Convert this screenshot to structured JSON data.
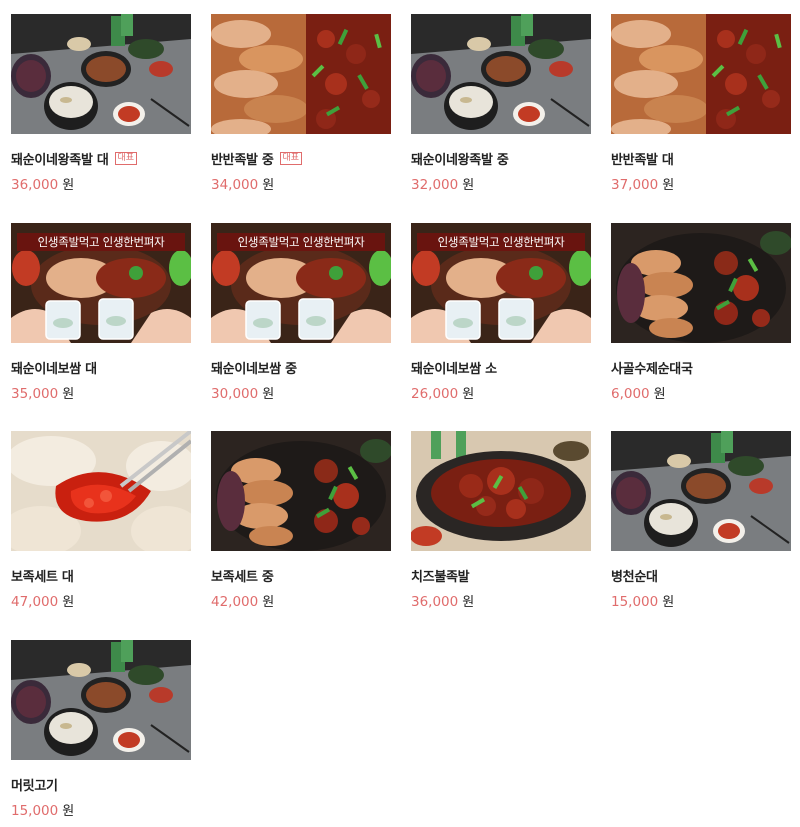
{
  "products": [
    {
      "name": "돼순이네왕족발 대",
      "price": "36,000",
      "unit": "원",
      "badge": "대표",
      "banner": "",
      "photo": "table-spread"
    },
    {
      "name": "반반족발 중",
      "price": "34,000",
      "unit": "원",
      "badge": "대표",
      "banner": "",
      "photo": "half-half-jokbal"
    },
    {
      "name": "돼순이네왕족발 중",
      "price": "32,000",
      "unit": "원",
      "badge": "",
      "banner": "",
      "photo": "table-spread"
    },
    {
      "name": "반반족발 대",
      "price": "37,000",
      "unit": "원",
      "badge": "",
      "banner": "",
      "photo": "half-half-jokbal"
    },
    {
      "name": "돼순이네보쌈 대",
      "price": "35,000",
      "unit": "원",
      "badge": "",
      "banner": "인생족발먹고 인생한번펴자",
      "photo": "bossam-toast"
    },
    {
      "name": "돼순이네보쌈 중",
      "price": "30,000",
      "unit": "원",
      "badge": "",
      "banner": "인생족발먹고 인생한번펴자",
      "photo": "bossam-toast"
    },
    {
      "name": "돼순이네보쌈 소",
      "price": "26,000",
      "unit": "원",
      "badge": "",
      "banner": "인생족발먹고 인생한번펴자",
      "photo": "bossam-toast"
    },
    {
      "name": "사골수제순대국",
      "price": "6,000",
      "unit": "원",
      "badge": "",
      "banner": "",
      "photo": "jokbal-platter"
    },
    {
      "name": "보족세트 대",
      "price": "47,000",
      "unit": "원",
      "badge": "",
      "banner": "",
      "photo": "bossam-kimchi"
    },
    {
      "name": "보족세트 중",
      "price": "42,000",
      "unit": "원",
      "badge": "",
      "banner": "",
      "photo": "jokbal-platter"
    },
    {
      "name": "치즈불족발",
      "price": "36,000",
      "unit": "원",
      "badge": "",
      "banner": "",
      "photo": "fire-jokbal"
    },
    {
      "name": "병천순대",
      "price": "15,000",
      "unit": "원",
      "badge": "",
      "banner": "",
      "photo": "table-spread"
    },
    {
      "name": "머릿고기",
      "price": "15,000",
      "unit": "원",
      "badge": "",
      "banner": "",
      "photo": "table-spread"
    }
  ],
  "colors": {
    "price": "#e06c6c",
    "badge": "#e06c6c",
    "name": "#222222"
  }
}
